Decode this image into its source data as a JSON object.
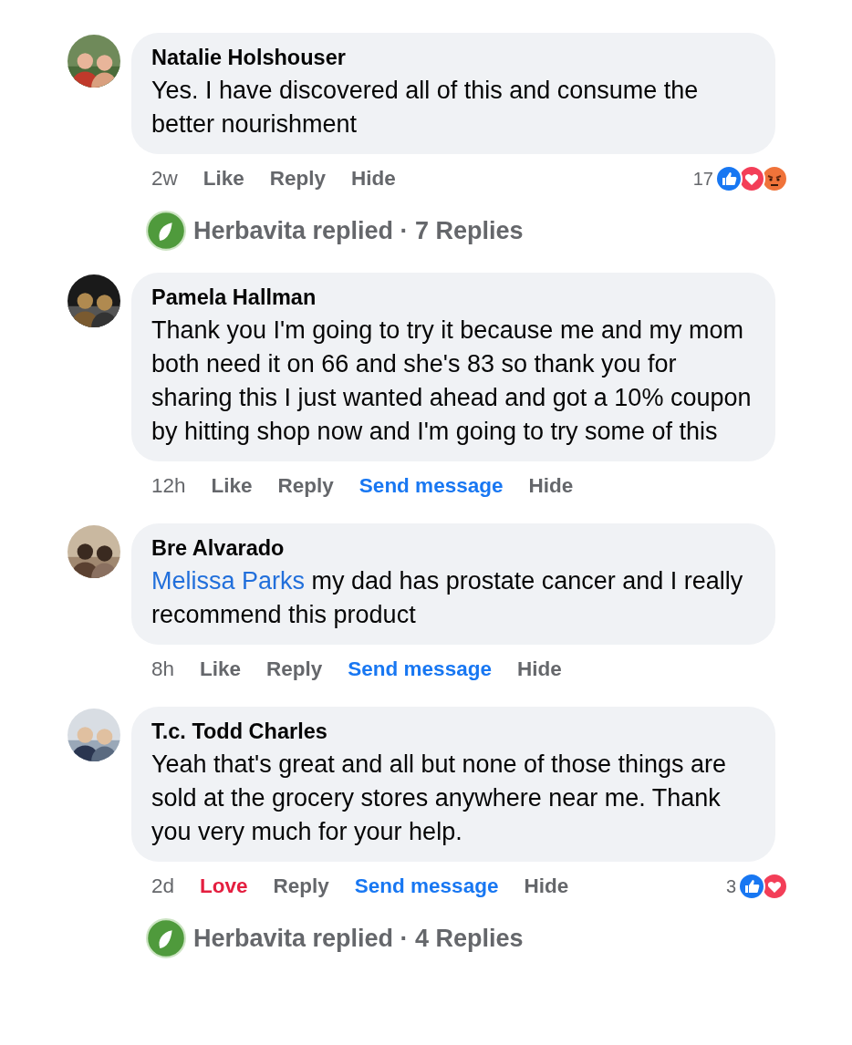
{
  "comments": [
    {
      "author": "Natalie Holshouser",
      "text": "Yes. I have discovered all of this and consume the better nourishment",
      "actions": [
        {
          "label": "2w",
          "kind": "time"
        },
        {
          "label": "Like",
          "kind": "plain"
        },
        {
          "label": "Reply",
          "kind": "plain"
        },
        {
          "label": "Hide",
          "kind": "plain"
        }
      ],
      "reactions": {
        "count": "17",
        "icons": [
          {
            "kind": "like"
          },
          {
            "kind": "love"
          },
          {
            "kind": "angry"
          }
        ]
      },
      "replies": "Herbavita replied · 7 Replies"
    },
    {
      "author": "Pamela Hallman",
      "text": "Thank you I'm going to try it because me and my mom both need it on 66 and she's 83 so thank you for sharing this I just wanted ahead and got a 10% coupon by hitting shop now and I'm going to try some of this",
      "actions": [
        {
          "label": "12h",
          "kind": "time"
        },
        {
          "label": "Like",
          "kind": "plain"
        },
        {
          "label": "Reply",
          "kind": "plain"
        },
        {
          "label": "Send message",
          "kind": "link"
        },
        {
          "label": "Hide",
          "kind": "plain"
        }
      ]
    },
    {
      "author": "Bre Alvarado",
      "mention": "Melissa Parks",
      "text": "my dad has prostate cancer and I really recommend this product",
      "actions": [
        {
          "label": "8h",
          "kind": "time"
        },
        {
          "label": "Like",
          "kind": "plain"
        },
        {
          "label": "Reply",
          "kind": "plain"
        },
        {
          "label": "Send message",
          "kind": "link"
        },
        {
          "label": "Hide",
          "kind": "plain"
        }
      ]
    },
    {
      "author": "T.c. Todd Charles",
      "text": "Yeah that's great and all but none of those things are sold at the grocery stores anywhere near me. Thank you very much for your help.",
      "actions": [
        {
          "label": "2d",
          "kind": "time"
        },
        {
          "label": "Love",
          "kind": "reacted"
        },
        {
          "label": "Reply",
          "kind": "plain"
        },
        {
          "label": "Send message",
          "kind": "link"
        },
        {
          "label": "Hide",
          "kind": "plain"
        }
      ],
      "reactions": {
        "count": "3",
        "icons": [
          {
            "kind": "like"
          },
          {
            "kind": "love"
          }
        ]
      },
      "replies": "Herbavita replied · 4 Replies"
    }
  ]
}
